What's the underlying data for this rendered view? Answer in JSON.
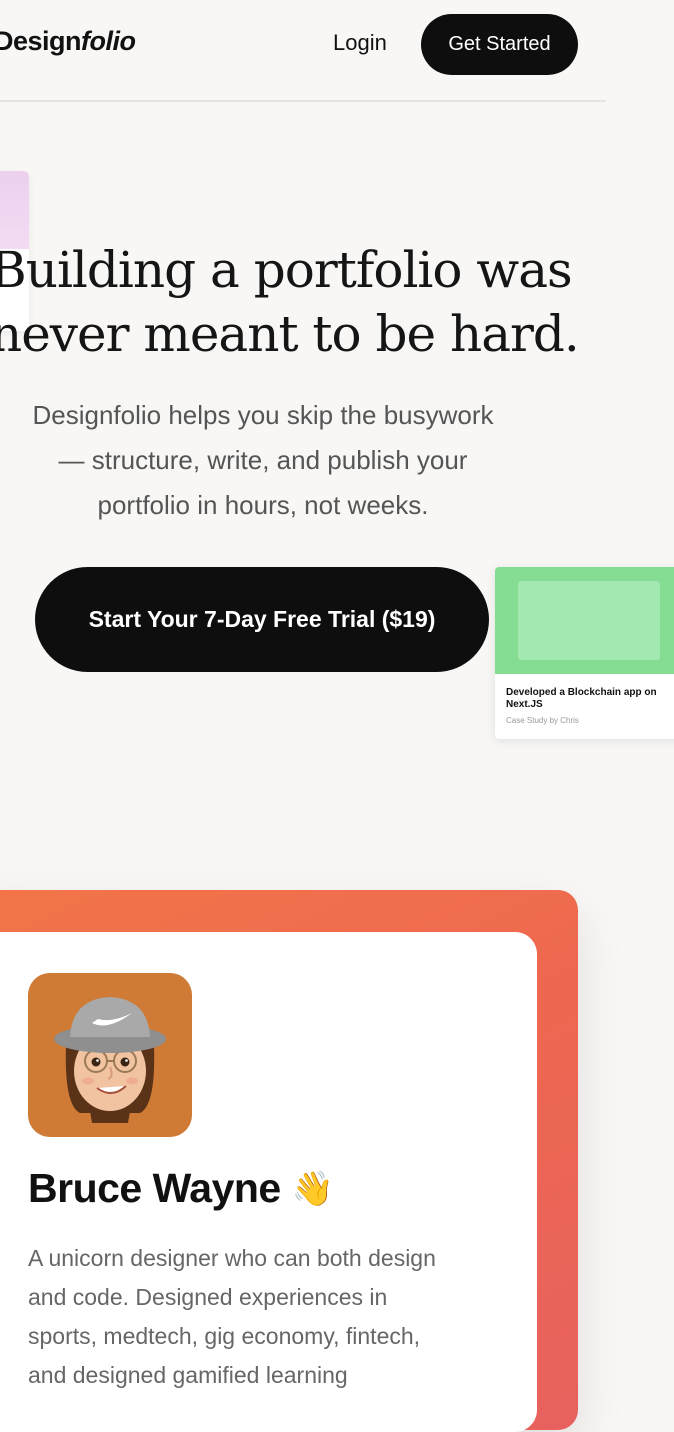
{
  "nav": {
    "logo_regular": "Design",
    "logo_italic": "folio",
    "login_label": "Login",
    "get_started_label": "Get Started"
  },
  "hero": {
    "headline_lines": [
      "Building a portfolio was",
      "never meant to be hard."
    ],
    "subtext_lines": [
      "Designfolio helps you skip the busywork",
      "— structure, write, and publish your",
      "portfolio in hours, not weeks."
    ],
    "cta_label": "Start Your 7-Day Free Trial ($19)"
  },
  "case_card": {
    "title": "Developed a Blockchain app on Next.JS",
    "subtitle": "Case Study by Chris",
    "thumb_color": "#84dd93"
  },
  "profile": {
    "name": "Bruce Wayne",
    "emoji": "👋",
    "avatar_hat_text": "NIKE",
    "bio_lines": [
      "A unicorn designer who can both design",
      "and code. Designed experiences in",
      "sports, medtech, gig economy, fintech,",
      "and designed gamified learning"
    ]
  },
  "colors": {
    "background": "#f8f7f5",
    "button_dark": "#0e0e0e",
    "orange_gradient_start": "#f27548",
    "orange_gradient_end": "#e8615e",
    "avatar_bg": "#cf7b35"
  }
}
